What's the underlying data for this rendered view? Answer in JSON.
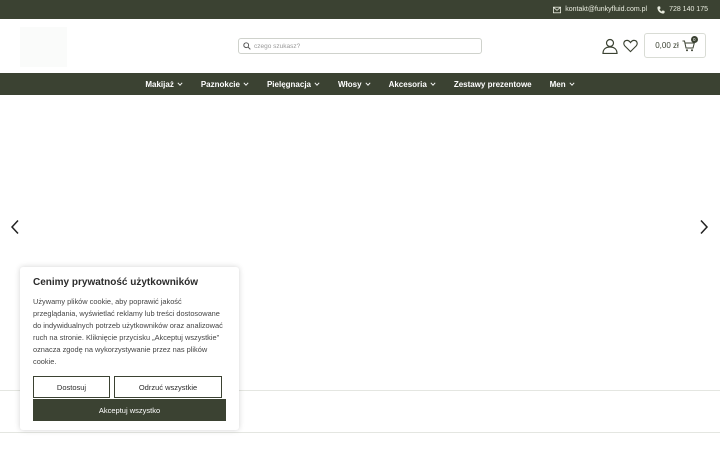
{
  "topbar": {
    "email": "kontakt@funkyfluid.com.pl",
    "phone": "728 140 175",
    "bg_color": "#3b4232"
  },
  "header": {
    "search_placeholder": "czego szukasz?",
    "cart_total": "0,00 zł",
    "cart_count": "0"
  },
  "nav": {
    "items": [
      {
        "label": "Makijaż",
        "has_dropdown": true
      },
      {
        "label": "Paznokcie",
        "has_dropdown": true
      },
      {
        "label": "Pielęgnacja",
        "has_dropdown": true
      },
      {
        "label": "Włosy",
        "has_dropdown": true
      },
      {
        "label": "Akcesoria",
        "has_dropdown": true
      },
      {
        "label": "Zestawy prezentowe",
        "has_dropdown": false
      },
      {
        "label": "Men",
        "has_dropdown": true
      }
    ]
  },
  "cookie": {
    "title": "Cenimy prywatność użytkowników",
    "text": "Używamy plików cookie, aby poprawić jakość przeglądania, wyświetlać reklamy lub treści dostosowane do indywidualnych potrzeb użytkowników oraz analizować ruch na stronie. Kliknięcie przycisku „Akceptuj wszystkie” oznacza zgodę na wykorzystywanie przez nas plików cookie.",
    "customize_label": "Dostosuj",
    "reject_label": "Odrzuć wszystkie",
    "accept_label": "Akceptuj wszystko"
  },
  "icons": {
    "mail": "mail-icon",
    "phone": "phone-icon",
    "search": "search-icon",
    "user": "user-icon",
    "heart": "heart-icon",
    "cart": "cart-icon",
    "chevron": "chevron-down-icon",
    "prev": "chevron-left-icon",
    "next": "chevron-right-icon"
  }
}
